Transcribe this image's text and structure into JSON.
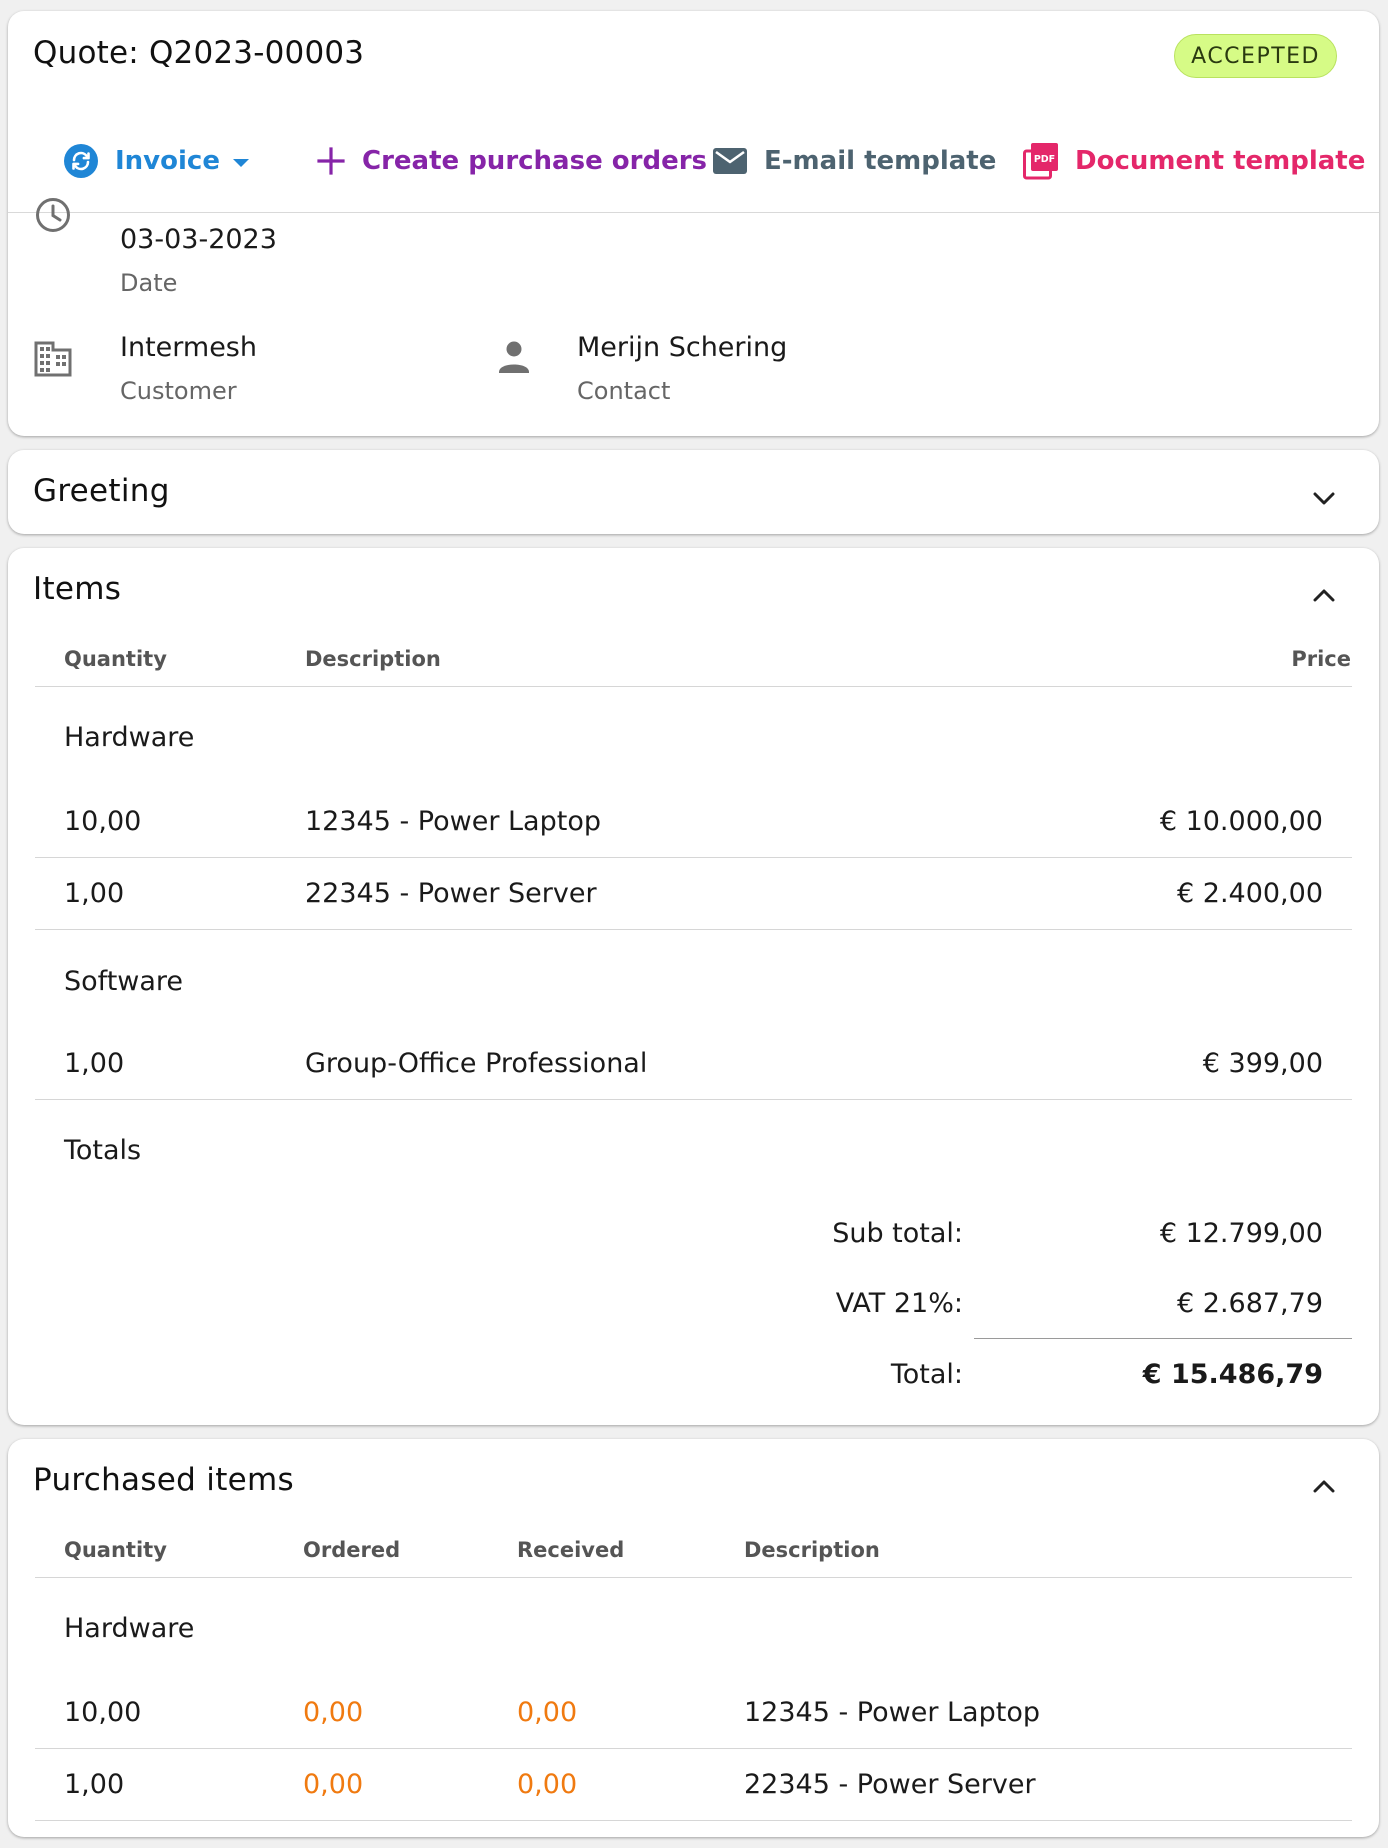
{
  "header": {
    "title": "Quote: Q2023-00003",
    "status": "ACCEPTED",
    "toolbar": {
      "invoice": "Invoice",
      "create_po": "Create purchase orders",
      "email_template": "E-mail template",
      "document_template": "Document template"
    },
    "date": {
      "value": "03-03-2023",
      "label": "Date"
    },
    "customer": {
      "value": "Intermesh",
      "label": "Customer"
    },
    "contact": {
      "value": "Merijn Schering",
      "label": "Contact"
    },
    "pdf_icon_text": "PDF"
  },
  "greeting": {
    "title": "Greeting"
  },
  "items": {
    "title": "Items",
    "columns": {
      "quantity": "Quantity",
      "description": "Description",
      "price": "Price"
    },
    "groups": [
      {
        "label": "Hardware",
        "rows": [
          {
            "quantity": "10,00",
            "description": "12345 - Power Laptop",
            "price": "€ 10.000,00"
          },
          {
            "quantity": "1,00",
            "description": "22345 - Power Server",
            "price": "€ 2.400,00"
          }
        ]
      },
      {
        "label": "Software",
        "rows": [
          {
            "quantity": "1,00",
            "description": "Group-Office Professional",
            "price": "€ 399,00"
          }
        ]
      }
    ],
    "totals": {
      "label": "Totals",
      "subtotal_label": "Sub total:",
      "subtotal_value": "€ 12.799,00",
      "vat_label": "VAT 21%:",
      "vat_value": "€ 2.687,79",
      "total_label": "Total:",
      "total_value": "€ 15.486,79"
    }
  },
  "purchased": {
    "title": "Purchased items",
    "columns": {
      "quantity": "Quantity",
      "ordered": "Ordered",
      "received": "Received",
      "description": "Description"
    },
    "groups": [
      {
        "label": "Hardware",
        "rows": [
          {
            "quantity": "10,00",
            "ordered": "0,00",
            "received": "0,00",
            "description": "12345 - Power Laptop"
          },
          {
            "quantity": "1,00",
            "ordered": "0,00",
            "received": "0,00",
            "description": "22345 - Power Server"
          }
        ]
      }
    ]
  },
  "colors": {
    "accepted_badge": "#d6fb86",
    "invoice_blue": "#1f86d6",
    "purchase_purple": "#8624a8",
    "email_slate": "#4d6370",
    "document_pink": "#e4276a",
    "ordered_orange": "#f07a10"
  },
  "icons": {
    "invoice": "sync-icon",
    "create_po": "plus-icon",
    "email": "mail-icon",
    "document": "pdf-icon",
    "date": "clock-icon",
    "customer": "building-icon",
    "contact": "person-icon"
  }
}
